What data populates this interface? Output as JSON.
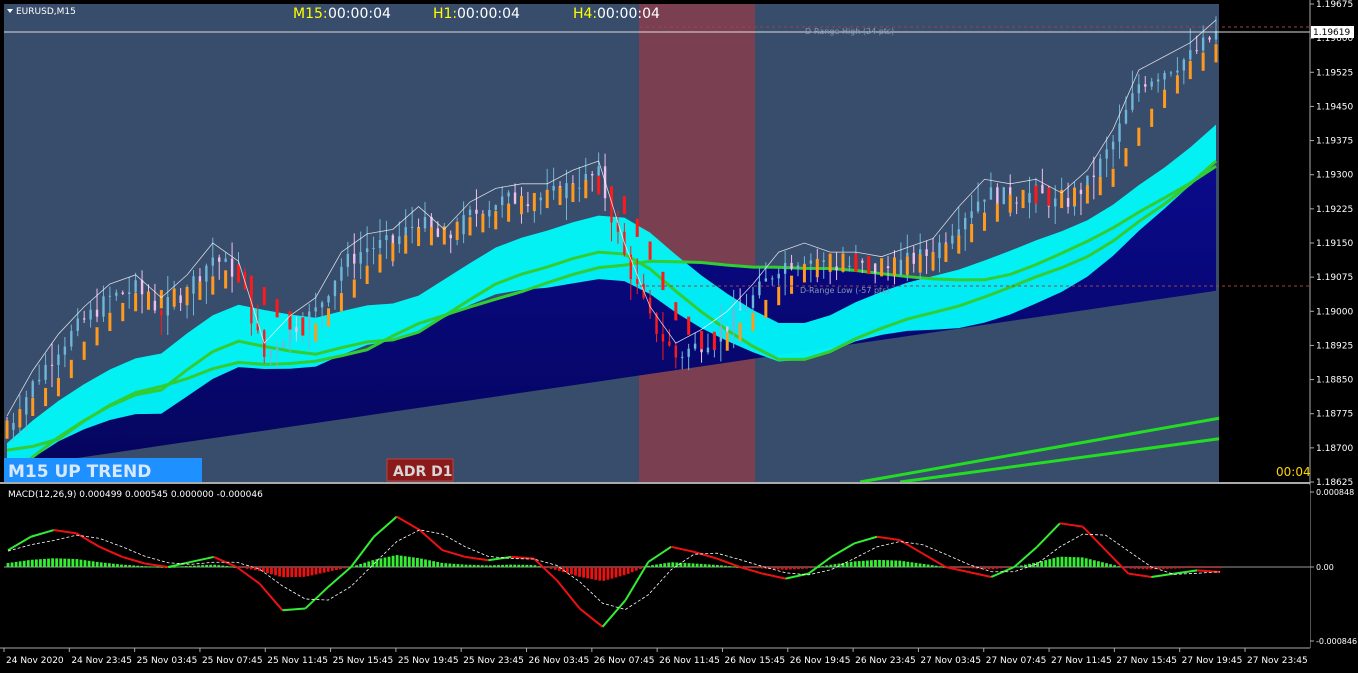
{
  "window": {
    "symbol_label": "EURUSD,M15"
  },
  "timers": [
    {
      "tf": "M15:",
      "value": "00:00:04"
    },
    {
      "tf": "H1:",
      "value": "00:00:04"
    },
    {
      "tf": "H4:",
      "value": "00:00:04"
    }
  ],
  "badges": {
    "trend": "M15   UP TREND",
    "adr": "ADR D1",
    "countdown": "00:04"
  },
  "levels": {
    "range_high_label": "D-Range High (24 pts)",
    "range_low_label": "D-Range Low (-57 pts)",
    "current_price": "1.19619"
  },
  "colors": {
    "main_bg": "#384C6C",
    "session_highlight": "#7B3F52",
    "up_band": "#00FFFF",
    "down_band": "#0A0A8C",
    "sma_green": "#32CD32",
    "bull_body": "#FF9A1F",
    "bear": "#FF1A1A",
    "macd_up": "#33EE33",
    "macd_down": "#EE1111",
    "trend_badge": "#1E90FF",
    "adr_badge": "#8B1A1A"
  },
  "chart_data": [
    {
      "type": "line",
      "title": "EURUSD,M15",
      "y_axis_ticks": [
        "1.19675",
        "1.19600",
        "1.19525",
        "1.19450",
        "1.19375",
        "1.19300",
        "1.19225",
        "1.19150",
        "1.19075",
        "1.19000",
        "1.18925",
        "1.18850",
        "1.18775",
        "1.18700",
        "1.18625"
      ],
      "ylim": [
        1.18625,
        1.19675
      ],
      "x_axis_ticks": [
        "24 Nov 2020",
        "24 Nov 23:45",
        "25 Nov 03:45",
        "25 Nov 07:45",
        "25 Nov 11:45",
        "25 Nov 15:45",
        "25 Nov 19:45",
        "25 Nov 23:45",
        "26 Nov 03:45",
        "26 Nov 07:45",
        "26 Nov 11:45",
        "26 Nov 15:45",
        "26 Nov 19:45",
        "26 Nov 23:45",
        "27 Nov 03:45",
        "27 Nov 07:45",
        "27 Nov 11:45",
        "27 Nov 15:45",
        "27 Nov 19:45",
        "27 Nov 23:45"
      ],
      "series": [
        {
          "values": [
            1.1874,
            1.1884,
            1.1892,
            1.1898,
            1.1903,
            1.1905,
            1.19,
            1.1905,
            1.1912,
            1.1908,
            1.189,
            1.1896,
            1.19,
            1.191,
            1.1914,
            1.1915,
            1.192,
            1.1915,
            1.1921,
            1.1924,
            1.1925,
            1.1925,
            1.1928,
            1.193,
            1.1912,
            1.1898,
            1.189,
            1.1893,
            1.1897,
            1.1903,
            1.191,
            1.1912,
            1.191,
            1.191,
            1.1909,
            1.1911,
            1.1913,
            1.192,
            1.1926,
            1.1925,
            1.1926,
            1.1923,
            1.1928,
            1.1937,
            1.195,
            1.1953,
            1.1956,
            1.1961
          ]
        }
      ]
    },
    {
      "type": "bar",
      "title": "MACD(12,26,9) 0.000499 0.000545 0.000000 -0.000046",
      "y_axis_ticks": [
        "0.000848",
        "0.00",
        "-0.000846"
      ],
      "ylim": [
        -0.000846,
        0.000848
      ],
      "series": [
        {
          "name": "MACD(12,26,9)",
          "values": [
            0.0001,
            0.00018,
            0.00022,
            0.0002,
            0.00012,
            6e-05,
            2e-05,
            0.0,
            3e-05,
            6e-05,
            0.0,
            -0.0001,
            -0.00026,
            -0.00025,
            -0.00012,
            0.0,
            0.00018,
            0.0003,
            0.00022,
            0.0001,
            6e-05,
            4e-05,
            6e-05,
            5e-05,
            -8e-05,
            -0.00025,
            -0.00036,
            -0.0002,
            3e-05,
            0.00012,
            9e-05,
            5e-05,
            0.0,
            -4e-05,
            -7e-05,
            -4e-05,
            6e-05,
            0.00014,
            0.00018,
            0.00016,
            8e-05,
            0.0,
            -3e-05,
            -6e-05,
            0.0,
            0.00012,
            0.00026,
            0.00024,
            0.0001,
            -4e-05,
            -6e-05,
            -4e-05,
            -2e-05,
            -3e-05
          ]
        }
      ]
    }
  ]
}
